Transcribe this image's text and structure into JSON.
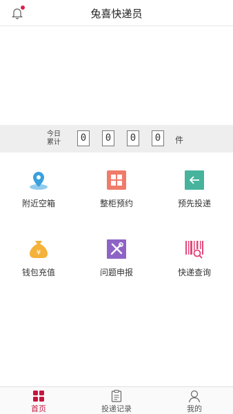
{
  "header": {
    "title": "兔喜快递员",
    "bell_icon": "bell-icon",
    "badge_color": "#d6204e"
  },
  "counter": {
    "label_line1": "今日",
    "label_line2": "累计",
    "digits": [
      "0",
      "0",
      "0",
      "0"
    ],
    "unit": "件"
  },
  "grid": [
    {
      "label": "附近空箱",
      "icon": "map-pin-icon",
      "color": "#3aa0dd"
    },
    {
      "label": "整柜预约",
      "icon": "grid-cabinet-icon",
      "color": "#f07b6a"
    },
    {
      "label": "预先投递",
      "icon": "back-arrow-icon",
      "color": "#47b39d"
    },
    {
      "label": "钱包充值",
      "icon": "money-bag-icon",
      "color": "#f4b23a"
    },
    {
      "label": "问题申报",
      "icon": "tools-icon",
      "color": "#8e63c6"
    },
    {
      "label": "快递查询",
      "icon": "barcode-search-icon",
      "color": "#e2477a"
    }
  ],
  "tabbar": [
    {
      "label": "首页",
      "icon": "home-grid-icon",
      "active": true
    },
    {
      "label": "投递记录",
      "icon": "clipboard-icon",
      "active": false
    },
    {
      "label": "我的",
      "icon": "user-icon",
      "active": false
    }
  ],
  "colors": {
    "accent": "#c5163f",
    "counter_bg": "#eeeeef"
  }
}
